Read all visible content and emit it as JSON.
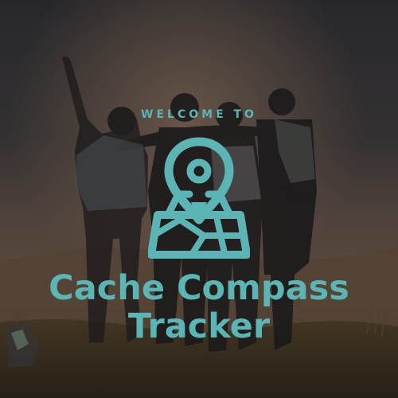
{
  "splash": {
    "welcome_text": "WELCOME TO",
    "app_name_line1": "Cache Compass",
    "app_name_line2": "Tracker",
    "logo_icon": "map-pin-on-map-icon",
    "background": "photo-friends-embracing-at-sunset-hill"
  },
  "colors": {
    "accent": "#5bb5b5",
    "overlay": "#2a2a2d"
  }
}
